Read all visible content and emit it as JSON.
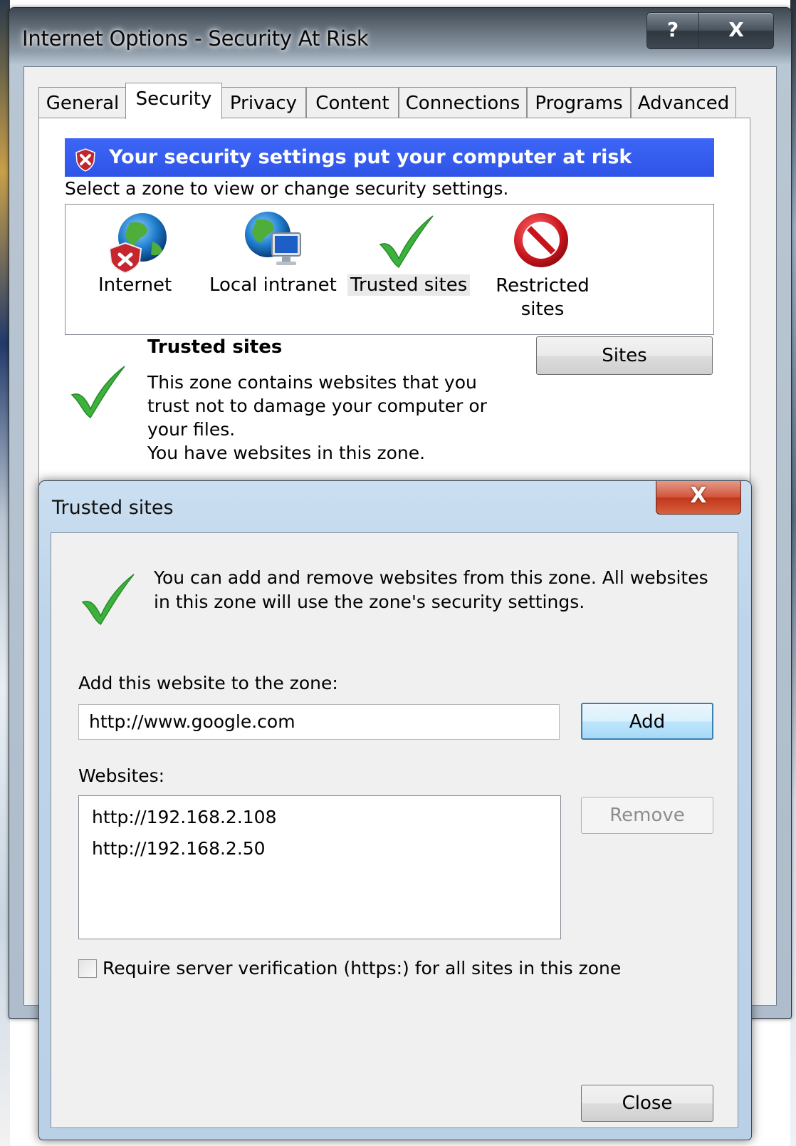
{
  "main_window": {
    "title": "Internet Options - Security At Risk",
    "help_button": "?",
    "close_button": "X",
    "tabs": [
      "General",
      "Security",
      "Privacy",
      "Content",
      "Connections",
      "Programs",
      "Advanced"
    ],
    "active_tab": "Security"
  },
  "security": {
    "risk_banner": "Your security settings put your computer at risk",
    "zone_prompt": "Select a zone to view or change security settings.",
    "zones": [
      {
        "label": "Internet",
        "icon": "globe-shield-icon"
      },
      {
        "label": "Local intranet",
        "icon": "globe-computer-icon"
      },
      {
        "label": "Trusted sites",
        "icon": "checkmark-icon"
      },
      {
        "label": "Restricted sites",
        "icon": "prohibited-icon"
      }
    ],
    "selected_zone_title": "Trusted sites",
    "selected_zone_desc": "This zone contains websites that you trust not to damage your computer or your files.",
    "selected_zone_status": "You have websites in this zone.",
    "sites_button": "Sites"
  },
  "dialog": {
    "title": "Trusted sites",
    "close_button": "X",
    "message": "You can add and remove websites from this zone. All websites in this zone will use the zone's security settings.",
    "add_label": "Add this website to the zone:",
    "url_value": "http://www.google.com",
    "add_button": "Add",
    "websites_label": "Websites:",
    "websites": [
      "http://192.168.2.108",
      "http://192.168.2.50"
    ],
    "remove_button": "Remove",
    "require_https_label": "Require server verification (https:) for all sites in this zone",
    "require_https_checked": false,
    "close_dialog_button": "Close"
  }
}
